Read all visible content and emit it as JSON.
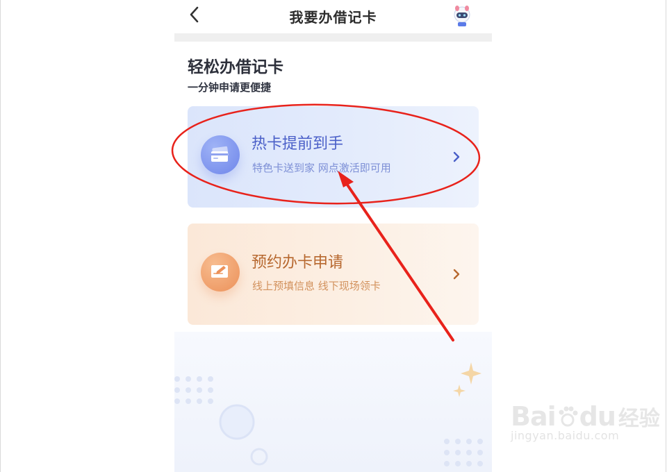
{
  "nav": {
    "title": "我要办借记卡"
  },
  "header": {
    "title": "轻松办借记卡",
    "subtitle": "一分钟申请更便捷"
  },
  "cards": [
    {
      "title": "热卡提前到手",
      "desc": "特色卡送到家 网点激活即可用",
      "icon": "card-icon",
      "accent": "#4a5fc8"
    },
    {
      "title": "预约办卡申请",
      "desc": "线上预填信息 线下现场领卡",
      "icon": "form-icon",
      "accent": "#b7682f"
    }
  ],
  "watermark": {
    "logo": "Bai",
    "logo_end": "du",
    "brand": "经验",
    "url": "jingyan.baidu.com"
  },
  "colors": {
    "annotation": "#e8221b",
    "nav_divider": "#efefef"
  }
}
